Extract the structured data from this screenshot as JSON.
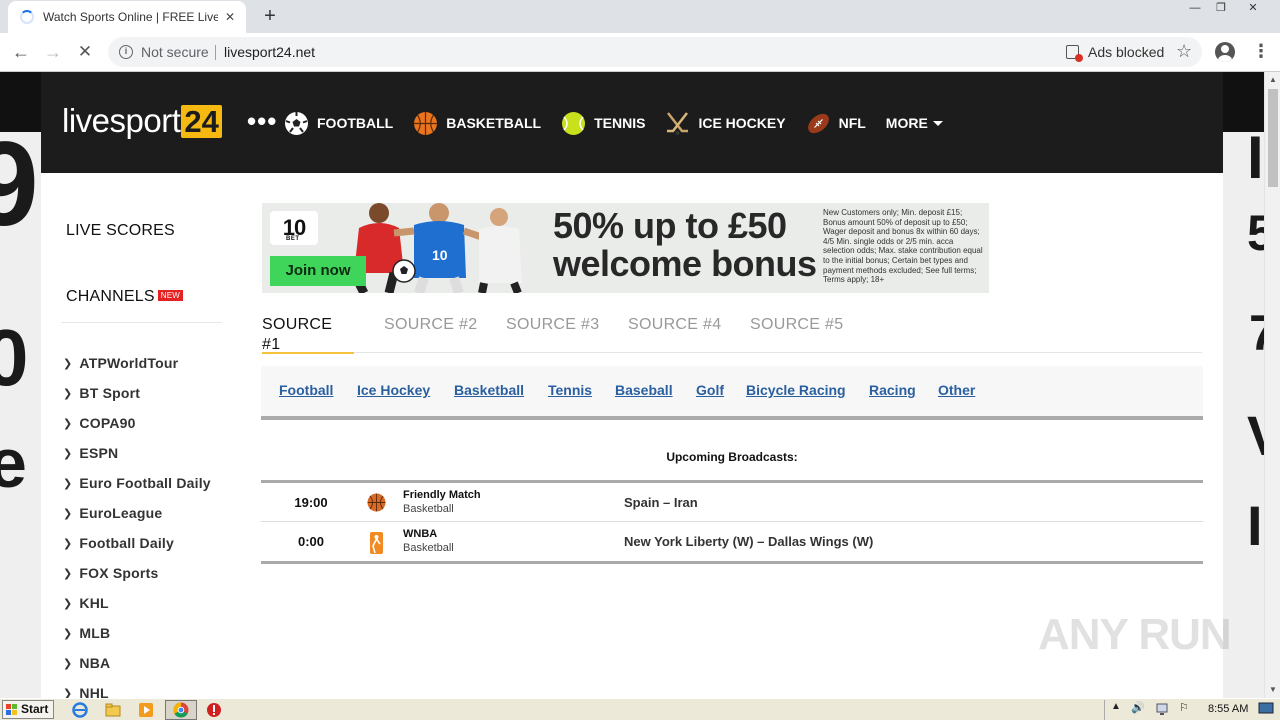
{
  "browser": {
    "tab_title": "Watch Sports Online | FREE Live Spo",
    "tab_close": "✕",
    "new_tab": "+",
    "security_label": "Not secure",
    "url": "livesport24.net",
    "ads_blocked_label": "Ads blocked"
  },
  "site": {
    "logo_text": "livesport",
    "logo_number": "24",
    "nav": [
      {
        "label": "FOOTBALL",
        "icon": "football-icon"
      },
      {
        "label": "BASKETBALL",
        "icon": "basketball-icon"
      },
      {
        "label": "TENNIS",
        "icon": "tennis-ball-icon"
      },
      {
        "label": "ICE HOCKEY",
        "icon": "hockey-sticks-icon"
      },
      {
        "label": "NFL",
        "icon": "american-football-icon"
      }
    ],
    "nav_more": "MORE"
  },
  "sidebar": {
    "live_scores": "LIVE SCORES",
    "channels": "CHANNELS",
    "channels_badge": "NEW",
    "items": [
      "ATPWorldTour",
      "BT Sport",
      "COPA90",
      "ESPN",
      "Euro Football Daily",
      "EuroLeague",
      "Football Daily",
      "FOX Sports",
      "KHL",
      "MLB",
      "NBA",
      "NHL"
    ]
  },
  "banner": {
    "brand": "10",
    "brand_sub": "BET",
    "join_label": "Join now",
    "headline": "50% up to £50 welcome bonus",
    "fine_print": "New Customers only; Min. deposit £15; Bonus amount 50% of deposit up to £50; Wager deposit and bonus 8x within 60 days; 4/5 Min. single odds or 2/5 min. acca selection odds; Max. stake contribution equal to the initial bonus; Certain bet types and payment methods excluded; See full terms; Terms apply; 18+"
  },
  "sources": {
    "tabs": [
      "SOURCE #1",
      "SOURCE #2",
      "SOURCE #3",
      "SOURCE #4",
      "SOURCE #5"
    ],
    "active_index": 0
  },
  "categories": [
    "Football",
    "Ice Hockey",
    "Basketball",
    "Tennis",
    "Baseball",
    "Golf",
    "Bicycle Racing",
    "Racing",
    "Other"
  ],
  "broadcasts": {
    "heading": "Upcoming Broadcasts:",
    "rows": [
      {
        "time": "19:00",
        "event": "Friendly Match",
        "sport": "Basketball",
        "teams": "Spain – Iran",
        "icon": "basketball-icon"
      },
      {
        "time": "0:00",
        "event": "WNBA",
        "sport": "Basketball",
        "teams": "New York Liberty (W) – Dallas Wings (W)",
        "icon": "wnba-logo-icon"
      }
    ]
  },
  "watermark": "ANY RUN",
  "taskbar": {
    "start_label": "Start",
    "clock": "8:55 AM"
  }
}
